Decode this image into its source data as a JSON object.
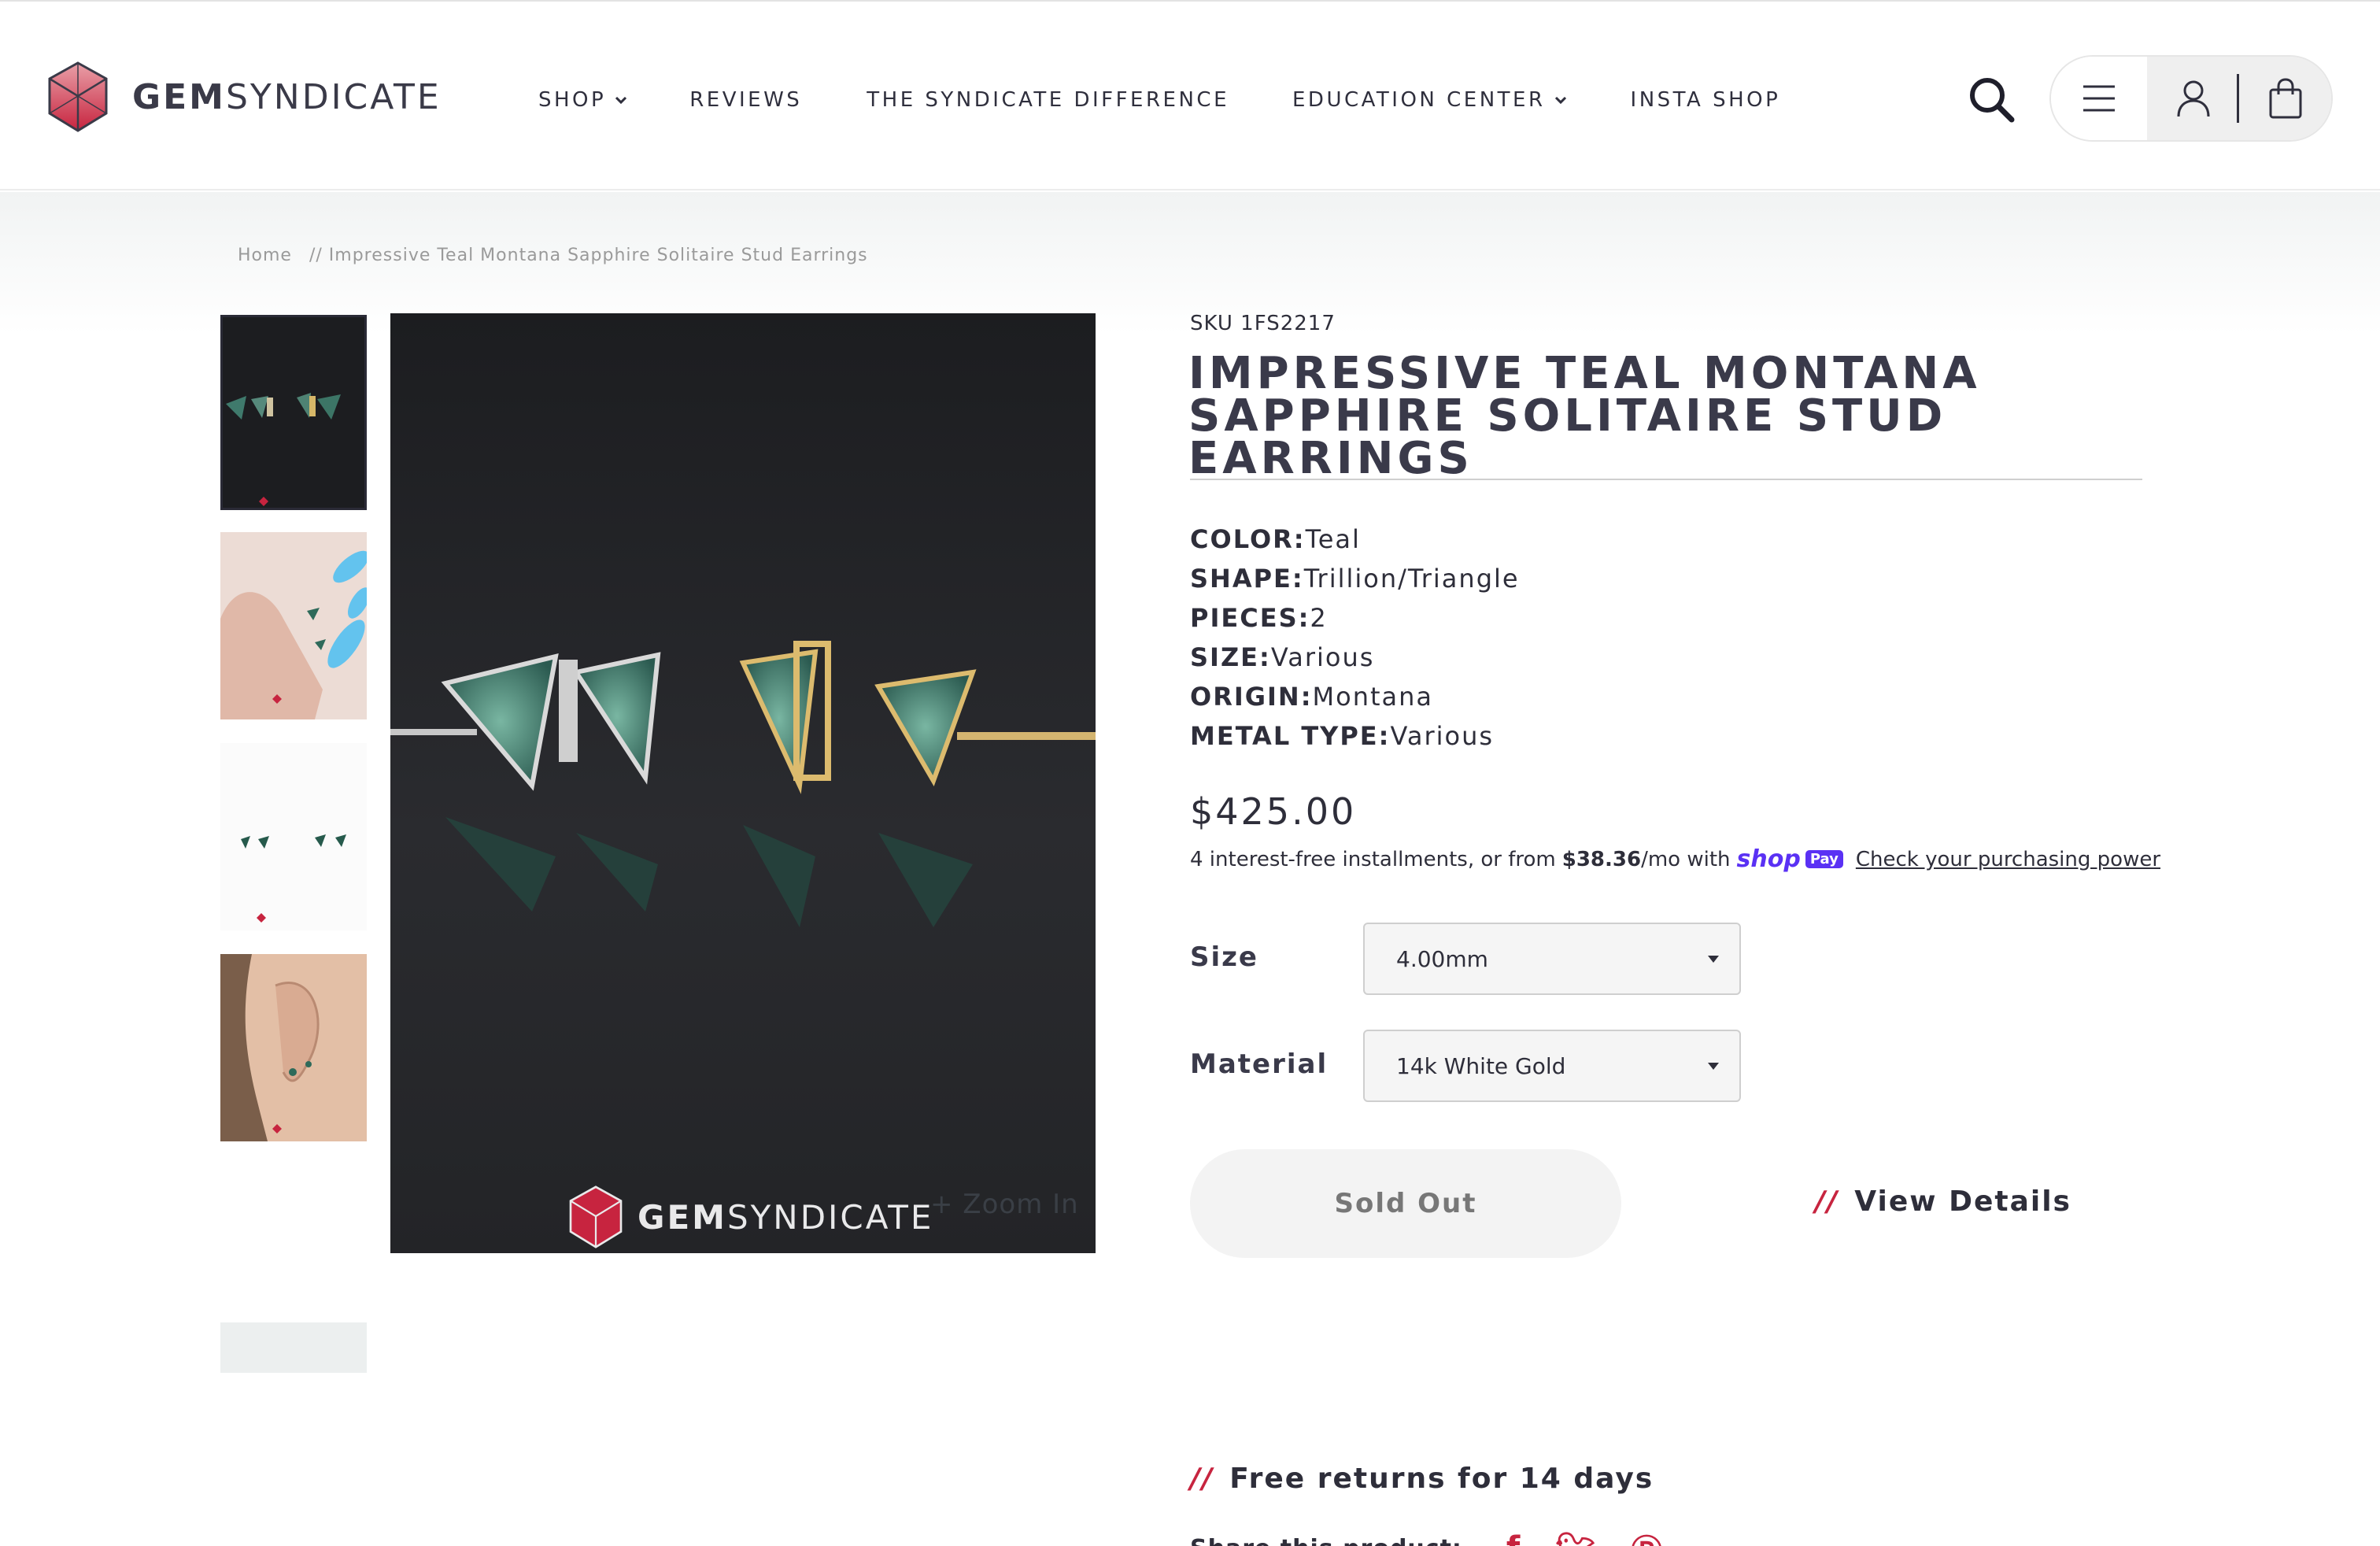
{
  "brand": {
    "logo_bold": "GEM",
    "logo_light": "SYNDICATE",
    "accent_color": "#c7243f"
  },
  "nav": {
    "shop": "SHOP",
    "reviews": "REVIEWS",
    "difference": "THE SYNDICATE DIFFERENCE",
    "education": "EDUCATION CENTER",
    "insta": "INSTA SHOP"
  },
  "breadcrumb": {
    "home": "Home",
    "separator": "//",
    "current": "Impressive Teal Montana Sapphire Solitaire Stud Earrings"
  },
  "gallery": {
    "zoom_label": "+ Zoom In"
  },
  "product": {
    "sku": "SKU 1FS2217",
    "title": "IMPRESSIVE TEAL MONTANA SAPPHIRE SOLITAIRE STUD EARRINGS",
    "specs": [
      {
        "label": "COLOR:",
        "value": "Teal"
      },
      {
        "label": "SHAPE:",
        "value": "Trillion/Triangle"
      },
      {
        "label": "PIECES:",
        "value": "2"
      },
      {
        "label": "SIZE:",
        "value": "Various"
      },
      {
        "label": "ORIGIN:",
        "value": "Montana"
      },
      {
        "label": "METAL TYPE:",
        "value": "Various"
      }
    ],
    "price": "$425.00",
    "installments_prefix": "4 interest-free installments, or from",
    "installments_amount": "$38.36",
    "installments_suffix": "/mo with",
    "shop_logo": "shop",
    "pay_badge": "Pay",
    "check_link": "Check your purchasing power"
  },
  "options": {
    "size_label": "Size",
    "size_value": "4.00mm",
    "material_label": "Material",
    "material_value": "14k White Gold"
  },
  "actions": {
    "sold_out": "Sold Out",
    "slashes": "//",
    "view_details": "View Details",
    "free_returns": "Free returns for 14 days",
    "share_label": "Share this product:"
  }
}
